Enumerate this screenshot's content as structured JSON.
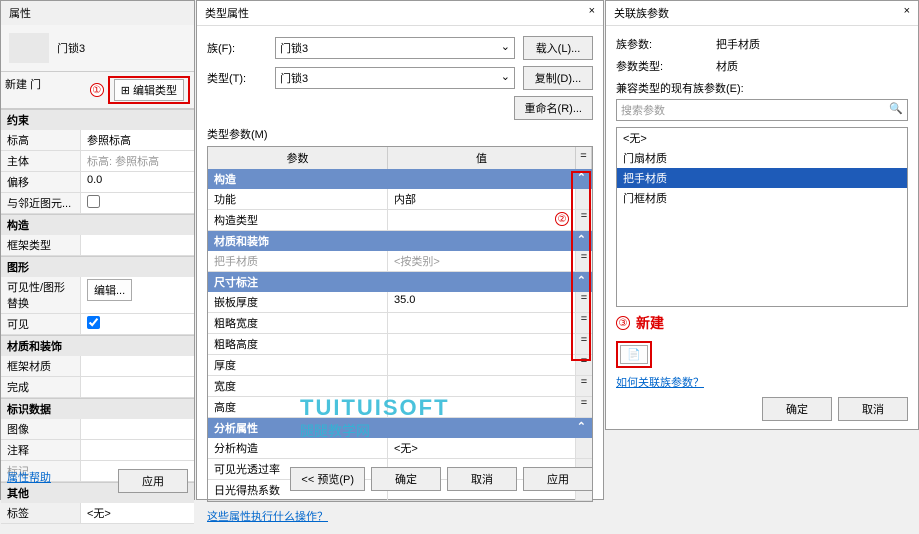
{
  "prop": {
    "title": "属性",
    "family": "门锁3",
    "new_label": "新建 门",
    "edit_type": "编辑类型",
    "num1": "①",
    "sections": {
      "constraint": "约束",
      "level_k": "标高",
      "level_v": "参照标高",
      "host_k": "主体",
      "host_v": "标高: 参照标高",
      "offset_k": "偏移",
      "offset_v": "0.0",
      "near_k": "与邻近图元...",
      "construct": "构造",
      "frame_type_k": "框架类型",
      "graphics": "图形",
      "vis_k": "可见性/图形替换",
      "vis_btn": "编辑...",
      "visible_k": "可见",
      "matdec": "材质和装饰",
      "frame_mat_k": "框架材质",
      "finish_k": "完成",
      "iddata": "标识数据",
      "image_k": "图像",
      "note_k": "注释",
      "mark_k": "标记",
      "other": "其他",
      "label_k": "标签",
      "label_v": "<无>"
    },
    "help": "属性帮助",
    "apply": "应用"
  },
  "type": {
    "title": "类型属性",
    "family_lbl": "族(F):",
    "type_lbl": "类型(T):",
    "family_val": "门锁3",
    "type_val": "门锁3",
    "load": "载入(L)...",
    "dup": "复制(D)...",
    "rename": "重命名(R)...",
    "param_lbl": "类型参数(M)",
    "col_param": "参数",
    "col_val": "值",
    "num2": "②",
    "cats": {
      "construct": "构造",
      "func_k": "功能",
      "func_v": "内部",
      "ctype_k": "构造类型",
      "matdec": "材质和装饰",
      "handle_k": "把手材质",
      "handle_v": "<按类别>",
      "dim": "尺寸标注",
      "inset_k": "嵌板厚度",
      "inset_v": "35.0",
      "rw_k": "粗略宽度",
      "rh_k": "粗略高度",
      "thick_k": "厚度",
      "width_k": "宽度",
      "height_k": "高度",
      "analysis": "分析属性",
      "ac_k": "分析构造",
      "ac_v": "<无>",
      "vlt_k": "可见光透过率",
      "shc_k": "日光得热系数"
    },
    "link_q": "这些属性执行什么操作？",
    "preview": "<< 预览(P)",
    "ok": "确定",
    "cancel": "取消",
    "apply": "应用"
  },
  "link": {
    "title": "关联族参数",
    "fp_lbl": "族参数:",
    "fp_val": "把手材质",
    "pt_lbl": "参数类型:",
    "pt_val": "材质",
    "compat": "兼容类型的现有族参数(E):",
    "search_ph": "搜索参数",
    "items": {
      "none": "<无>",
      "i1": "门扇材质",
      "i2": "把手材质",
      "i3": "门框材质"
    },
    "num3": "③",
    "new_btn": "新建",
    "howto": "如何关联族参数？",
    "ok": "确定",
    "cancel": "取消"
  }
}
